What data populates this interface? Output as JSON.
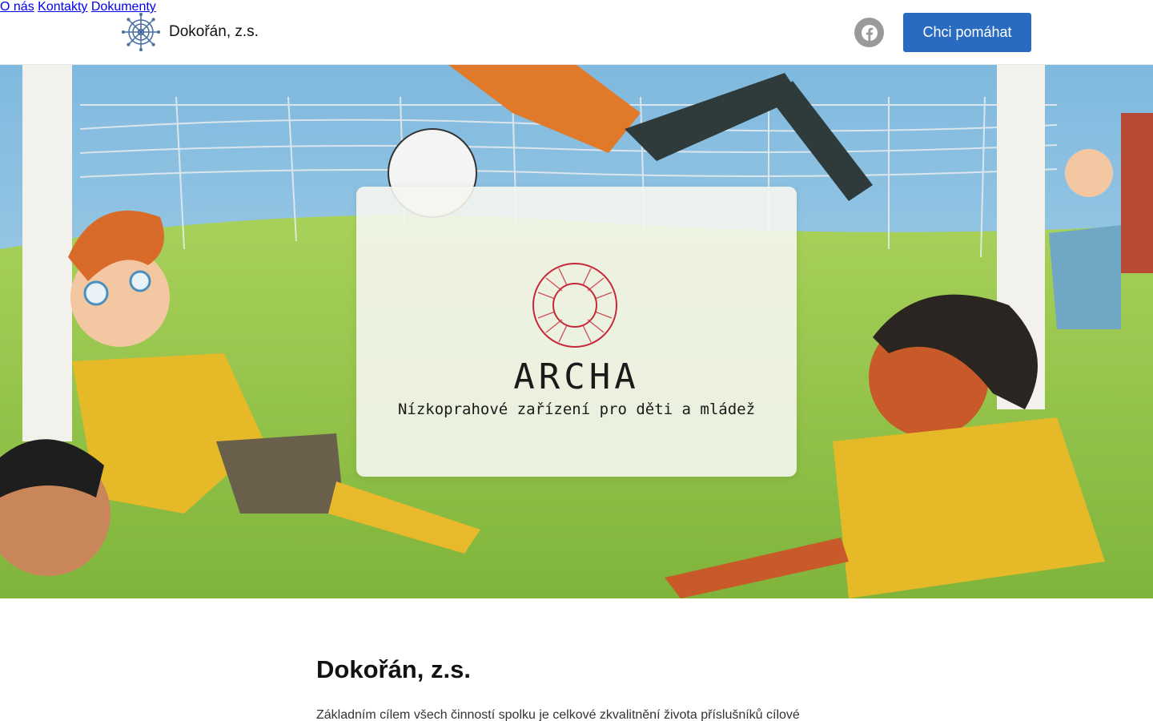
{
  "header": {
    "brand_name": "Dokořán, z.s.",
    "nav": [
      "O nás",
      "Kontakty",
      "Dokumenty"
    ],
    "facebook_icon": "facebook-icon",
    "cta_label": "Chci pomáhat"
  },
  "hero": {
    "logo_icon": "lifebuoy-icon",
    "title": "ARCHA",
    "subtitle": "Nízkoprahové zařízení pro děti a mládež"
  },
  "content": {
    "title": "Dokořán, z.s.",
    "text": "Základním cílem všech činností spolku je celkové zkvalitnění života příslušníků cílové"
  },
  "colors": {
    "accent": "#2a6bc2",
    "lifebuoy": "#c8283a",
    "facebook_circle": "#9a9a9a"
  }
}
